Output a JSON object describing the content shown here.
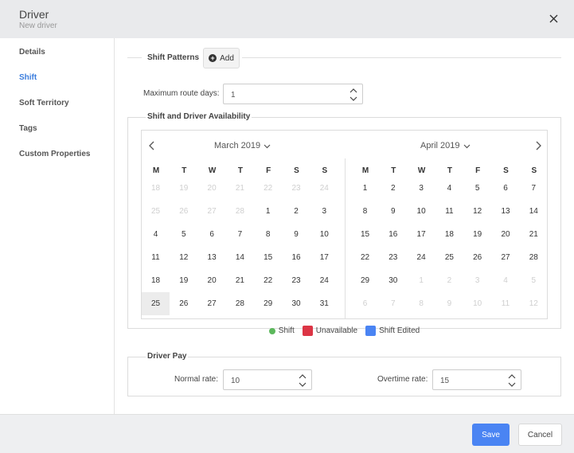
{
  "header": {
    "title": "Driver",
    "subtitle": "New driver",
    "close_icon": "close-icon"
  },
  "sidebar": {
    "items": [
      {
        "label": "Details",
        "active": false
      },
      {
        "label": "Shift",
        "active": true
      },
      {
        "label": "Soft Territory",
        "active": false
      },
      {
        "label": "Tags",
        "active": false
      },
      {
        "label": "Custom Properties",
        "active": false
      }
    ],
    "active_color": "#3b7ddd"
  },
  "shift_patterns": {
    "title": "Shift Patterns",
    "add_label": "Add",
    "add_icon": "plus-circle-icon"
  },
  "max_route_days": {
    "label": "Maximum route days:",
    "value": "1"
  },
  "availability": {
    "title": "Shift and Driver Availability",
    "weekdays": [
      "M",
      "T",
      "W",
      "T",
      "F",
      "S",
      "S"
    ],
    "months": [
      {
        "label": "March 2019",
        "weeks": [
          [
            "18",
            "19",
            "20",
            "21",
            "22",
            "23",
            "24"
          ],
          [
            "25",
            "26",
            "27",
            "28",
            "1",
            "2",
            "3"
          ],
          [
            "4",
            "5",
            "6",
            "7",
            "8",
            "9",
            "10"
          ],
          [
            "11",
            "12",
            "13",
            "14",
            "15",
            "16",
            "17"
          ],
          [
            "18",
            "19",
            "20",
            "21",
            "22",
            "23",
            "24"
          ],
          [
            "25",
            "26",
            "27",
            "28",
            "29",
            "30",
            "31"
          ]
        ],
        "muted": [
          [
            true,
            true,
            true,
            true,
            true,
            true,
            true
          ],
          [
            true,
            true,
            true,
            true,
            false,
            false,
            false
          ],
          [
            false,
            false,
            false,
            false,
            false,
            false,
            false
          ],
          [
            false,
            false,
            false,
            false,
            false,
            false,
            false
          ],
          [
            false,
            false,
            false,
            false,
            false,
            false,
            false
          ],
          [
            false,
            false,
            false,
            false,
            false,
            false,
            false
          ]
        ],
        "today": [
          5,
          0
        ]
      },
      {
        "label": "April 2019",
        "weeks": [
          [
            "1",
            "2",
            "3",
            "4",
            "5",
            "6",
            "7"
          ],
          [
            "8",
            "9",
            "10",
            "11",
            "12",
            "13",
            "14"
          ],
          [
            "15",
            "16",
            "17",
            "18",
            "19",
            "20",
            "21"
          ],
          [
            "22",
            "23",
            "24",
            "25",
            "26",
            "27",
            "28"
          ],
          [
            "29",
            "30",
            "1",
            "2",
            "3",
            "4",
            "5"
          ],
          [
            "6",
            "7",
            "8",
            "9",
            "10",
            "11",
            "12"
          ]
        ],
        "muted": [
          [
            false,
            false,
            false,
            false,
            false,
            false,
            false
          ],
          [
            false,
            false,
            false,
            false,
            false,
            false,
            false
          ],
          [
            false,
            false,
            false,
            false,
            false,
            false,
            false
          ],
          [
            false,
            false,
            false,
            false,
            false,
            false,
            false
          ],
          [
            false,
            false,
            true,
            true,
            true,
            true,
            true
          ],
          [
            true,
            true,
            true,
            true,
            true,
            true,
            true
          ]
        ]
      }
    ],
    "legend": [
      {
        "label": "Shift",
        "color": "#5cb85c",
        "shape": "dot"
      },
      {
        "label": "Unavailable",
        "color": "#dc3545",
        "shape": "square"
      },
      {
        "label": "Shift Edited",
        "color": "#4a84f3",
        "shape": "square"
      }
    ]
  },
  "driver_pay": {
    "title": "Driver Pay",
    "normal_label": "Normal rate:",
    "normal_value": "10",
    "overtime_label": "Overtime rate:",
    "overtime_value": "15"
  },
  "footer": {
    "save_label": "Save",
    "cancel_label": "Cancel",
    "save_color": "#4a84f3"
  }
}
